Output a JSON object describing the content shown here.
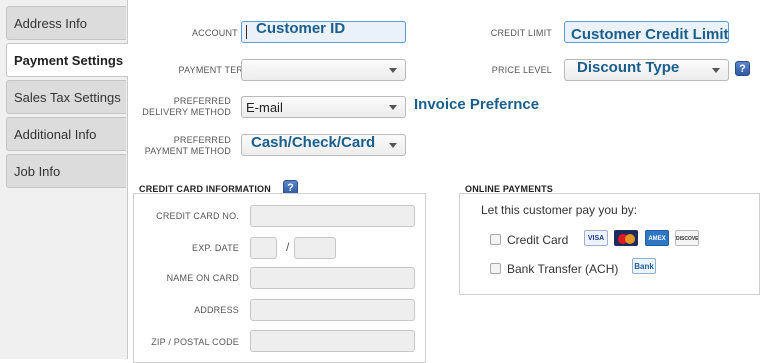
{
  "sidebar": {
    "tabs": [
      {
        "label": "Address Info"
      },
      {
        "label": "Payment Settings"
      },
      {
        "label": "Sales Tax Settings"
      },
      {
        "label": "Additional Info"
      },
      {
        "label": "Job Info"
      }
    ],
    "active_index": 1
  },
  "form": {
    "account_no": {
      "label": "ACCOUNT NO.",
      "annotation": "Customer ID",
      "value": ""
    },
    "credit_limit": {
      "label": "CREDIT LIMIT",
      "annotation": "Customer Credit Limit",
      "value": ""
    },
    "payment_terms": {
      "label": "PAYMENT TERMS",
      "value": ""
    },
    "price_level": {
      "label": "PRICE LEVEL",
      "annotation": "Discount Type",
      "value": ""
    },
    "delivery_method": {
      "label_line1": "PREFERRED",
      "label_line2": "DELIVERY METHOD",
      "value": "E-mail",
      "annotation": "Invoice Prefernce"
    },
    "payment_method": {
      "label_line1": "PREFERRED",
      "label_line2": "PAYMENT METHOD",
      "annotation": "Cash/Check/Card",
      "value": ""
    }
  },
  "credit_card": {
    "title": "CREDIT CARD INFORMATION",
    "help_icon": "?",
    "fields": {
      "card_no": "CREDIT CARD NO.",
      "exp_date": "EXP. DATE",
      "exp_separator": "/",
      "name_on_card": "NAME ON CARD",
      "address": "ADDRESS",
      "zip": "ZIP / POSTAL CODE"
    }
  },
  "online_payments": {
    "title": "ONLINE PAYMENTS",
    "prompt": "Let this customer pay you by:",
    "options": [
      {
        "label": "Credit Card",
        "checked": false
      },
      {
        "label": "Bank Transfer (ACH)",
        "checked": false
      }
    ],
    "card_logos": {
      "visa": "VISA",
      "mastercard": "MC",
      "amex": "AMEX",
      "discover": "DISCOVER"
    },
    "bank_logo": "Bank"
  },
  "help_icon": "?",
  "colors": {
    "annotation": "#1a5f8c",
    "help_icon": "#3b66ad",
    "annotation_box_border": "#5b9bd5"
  }
}
